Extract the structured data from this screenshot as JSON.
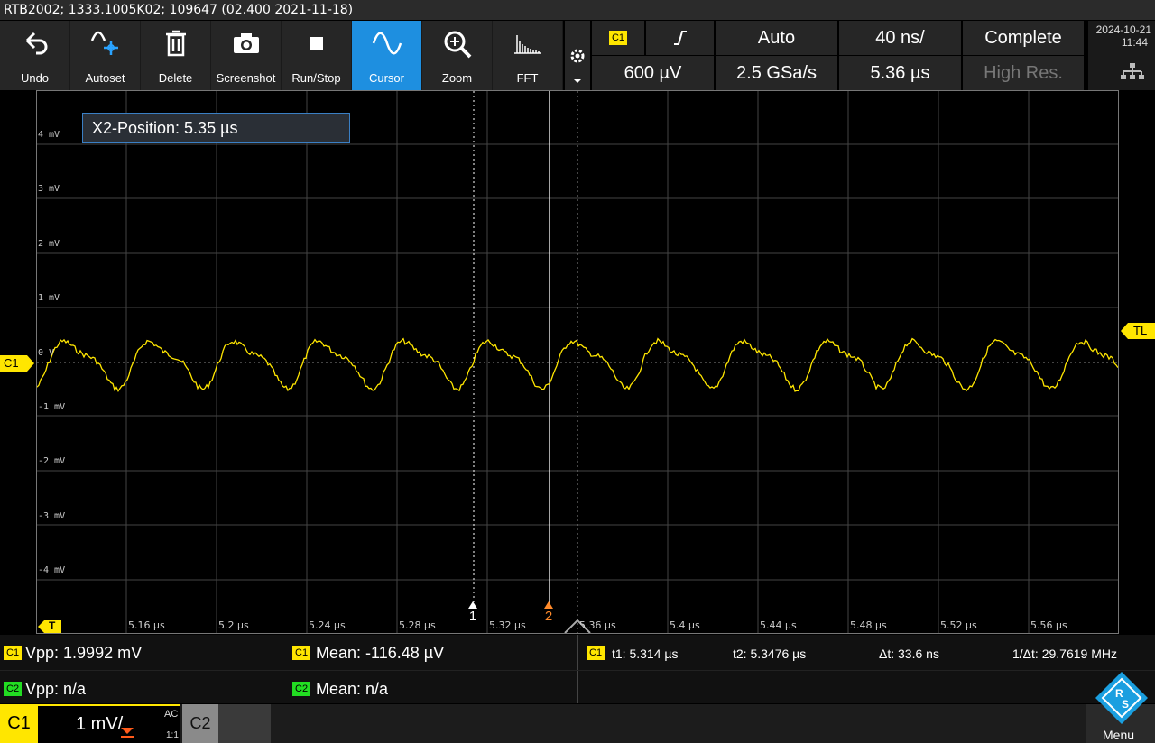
{
  "title": "RTB2002; 1333.1005K02; 109647 (02.400 2021-11-18)",
  "toolbar": [
    {
      "label": "Undo",
      "icon": "undo-icon"
    },
    {
      "label": "Autoset",
      "icon": "autoset-icon"
    },
    {
      "label": "Delete",
      "icon": "trash-icon"
    },
    {
      "label": "Screenshot",
      "icon": "camera-icon"
    },
    {
      "label": "Run/Stop",
      "icon": "stop-icon"
    },
    {
      "label": "Cursor",
      "icon": "cursor-wave-icon"
    },
    {
      "label": "Zoom",
      "icon": "zoom-icon"
    },
    {
      "label": "FFT",
      "icon": "fft-icon"
    }
  ],
  "trigger": {
    "channel": "C1",
    "mode": "Auto",
    "timebase": "40 ns/",
    "acq": "Complete",
    "level": "600 µV",
    "samplerate": "2.5 GSa/s",
    "position": "5.36 µs",
    "hires": "High Res."
  },
  "datetime": {
    "date": "2024-10-21",
    "time": "11:44"
  },
  "cursor_info": "X2-Position: 5.35 µs",
  "y_labels": [
    "4 mV",
    "3 mV",
    "2 mV",
    "1 mV",
    "0 V",
    "-1 mV",
    "-2 mV",
    "-3 mV",
    "-4 mV"
  ],
  "x_labels": [
    "5.16 µs",
    "5.2 µs",
    "5.24 µs",
    "5.28 µs",
    "5.32 µs",
    "5.36 µs",
    "5.4 µs",
    "5.44 µs",
    "5.48 µs",
    "5.52 µs",
    "5.56 µs"
  ],
  "markers": {
    "ch": "C1",
    "tl": "TL",
    "c1": "1",
    "c2": "2",
    "t": "T"
  },
  "measurements": {
    "c1_vpp": "Vpp: 1.9992 mV",
    "c1_mean": "Mean: -116.48 µV",
    "c2_vpp": "Vpp: n/a",
    "c2_mean": "Mean: n/a",
    "t1": "t1: 5.314 µs",
    "t2": "t2: 5.3476 µs",
    "dt": "Δt: 33.6 ns",
    "inv_dt": "1/Δt: 29.7619 MHz"
  },
  "channels": {
    "c1_label": "C1",
    "c1_scale": "1 mV/",
    "c1_coupling": "AC",
    "c1_ratio": "1:1",
    "c2_label": "C2",
    "c2_badge": "C2",
    "menu": "Menu"
  },
  "colors": {
    "trace": "#ffe600",
    "active": "#1e8fe0"
  }
}
